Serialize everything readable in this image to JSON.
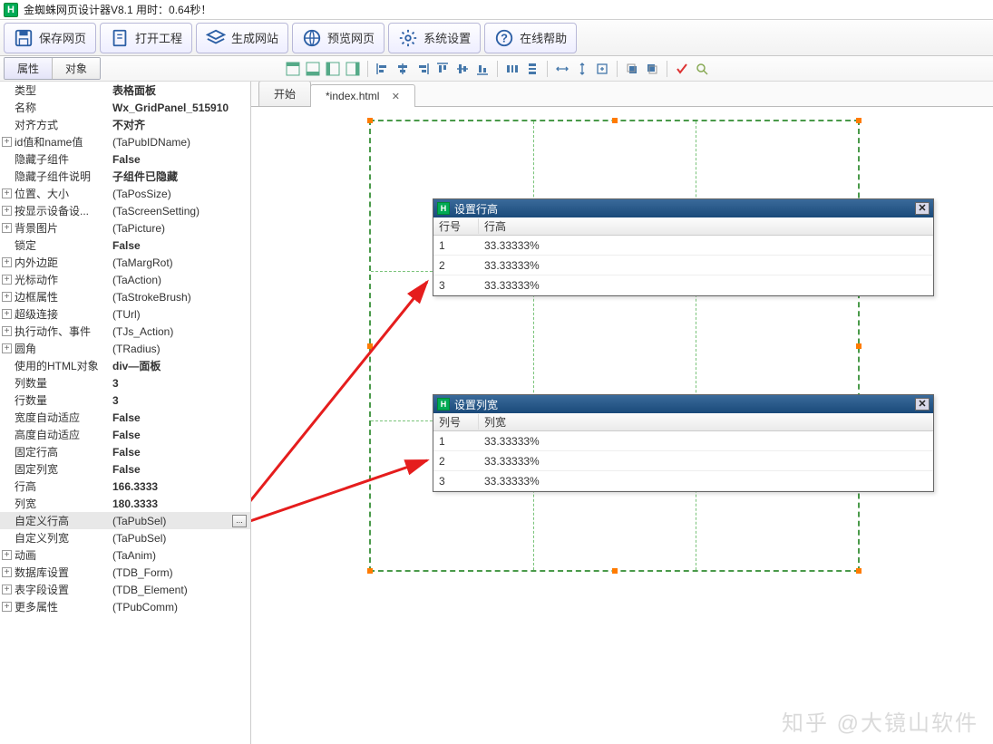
{
  "title": "金蜘蛛网页设计器V8.1 用时：0.64秒！",
  "titlebar_icon": "H",
  "toolbar": [
    {
      "id": "save",
      "label": "保存网页"
    },
    {
      "id": "open",
      "label": "打开工程"
    },
    {
      "id": "gen",
      "label": "生成网站"
    },
    {
      "id": "preview",
      "label": "预览网页"
    },
    {
      "id": "settings",
      "label": "系统设置"
    },
    {
      "id": "help",
      "label": "在线帮助"
    }
  ],
  "side_tabs": {
    "prop": "属性",
    "obj": "对象"
  },
  "props": [
    {
      "k": "类型",
      "v": "表格面板",
      "bold": true
    },
    {
      "k": "名称",
      "v": "Wx_GridPanel_515910",
      "bold": true
    },
    {
      "k": "对齐方式",
      "v": "不对齐",
      "bold": true
    },
    {
      "k": "id值和name值",
      "v": "(TaPubIDName)",
      "exp": true
    },
    {
      "k": "隐藏子组件",
      "v": "False",
      "bold": true
    },
    {
      "k": "隐藏子组件说明",
      "v": "子组件已隐藏",
      "bold": true
    },
    {
      "k": "位置、大小",
      "v": "(TaPosSize)",
      "exp": true
    },
    {
      "k": "按显示设备设...",
      "v": "(TaScreenSetting)",
      "exp": true
    },
    {
      "k": "背景图片",
      "v": "(TaPicture)",
      "exp": true
    },
    {
      "k": "锁定",
      "v": "False",
      "bold": true
    },
    {
      "k": "内外边距",
      "v": "(TaMargRot)",
      "exp": true
    },
    {
      "k": "光标动作",
      "v": "(TaAction)",
      "exp": true
    },
    {
      "k": "边框属性",
      "v": "(TaStrokeBrush)",
      "exp": true
    },
    {
      "k": "超级连接",
      "v": "(TUrl)",
      "exp": true
    },
    {
      "k": "执行动作、事件",
      "v": "(TJs_Action)",
      "exp": true
    },
    {
      "k": "圆角",
      "v": "(TRadius)",
      "exp": true
    },
    {
      "k": "使用的HTML对象",
      "v": "div—面板",
      "bold": true
    },
    {
      "k": "列数量",
      "v": "3",
      "bold": true
    },
    {
      "k": "行数量",
      "v": "3",
      "bold": true
    },
    {
      "k": "宽度自动适应",
      "v": "False",
      "bold": true
    },
    {
      "k": "高度自动适应",
      "v": "False",
      "bold": true
    },
    {
      "k": "固定行高",
      "v": "False",
      "bold": true
    },
    {
      "k": "固定列宽",
      "v": "False",
      "bold": true
    },
    {
      "k": "行高",
      "v": "166.3333",
      "bold": true
    },
    {
      "k": "列宽",
      "v": "180.3333",
      "bold": true
    },
    {
      "k": "自定义行高",
      "v": "(TaPubSel)",
      "sel": true
    },
    {
      "k": "自定义列宽",
      "v": "(TaPubSel)"
    },
    {
      "k": "动画",
      "v": "(TaAnim)",
      "exp": true
    },
    {
      "k": "数据库设置",
      "v": "(TDB_Form)",
      "exp": true
    },
    {
      "k": "表字段设置",
      "v": "(TDB_Element)",
      "exp": true
    },
    {
      "k": "更多属性",
      "v": "(TPubComm)",
      "exp": true
    }
  ],
  "doc_tabs": {
    "start": "开始",
    "file": "*index.html"
  },
  "dlg1": {
    "title": "设置行高",
    "h1": "行号",
    "h2": "行高",
    "rows": [
      {
        "n": "1",
        "v": "33.33333%"
      },
      {
        "n": "2",
        "v": "33.33333%"
      },
      {
        "n": "3",
        "v": "33.33333%"
      }
    ]
  },
  "dlg2": {
    "title": "设置列宽",
    "h1": "列号",
    "h2": "列宽",
    "rows": [
      {
        "n": "1",
        "v": "33.33333%"
      },
      {
        "n": "2",
        "v": "33.33333%"
      },
      {
        "n": "3",
        "v": "33.33333%"
      }
    ]
  },
  "watermark": "知乎 @大镜山软件"
}
